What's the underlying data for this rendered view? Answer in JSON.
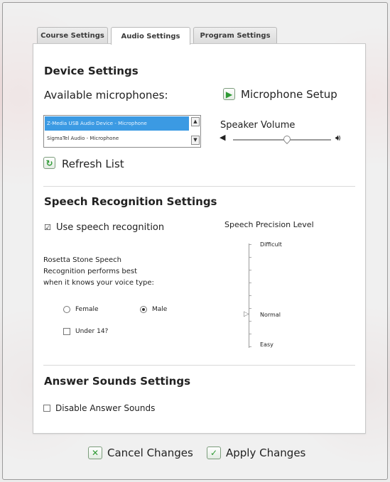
{
  "tabs": [
    {
      "label": "Course Settings"
    },
    {
      "label": "Audio Settings"
    },
    {
      "label": "Program Settings"
    }
  ],
  "device": {
    "title": "Device Settings",
    "available_label": "Available microphones:",
    "microphones": [
      "Z-Media USB Audio Device - Microphone",
      "SigmaTel Audio - Microphone"
    ],
    "mic_setup_label": "Microphone Setup",
    "speaker_volume_label": "Speaker Volume",
    "speaker_volume_level": 0.55,
    "refresh_label": "Refresh List"
  },
  "speech": {
    "title": "Speech Recognition Settings",
    "use_label": "Use speech recognition",
    "use_checked": true,
    "info_text_lines": [
      "Rosetta Stone Speech",
      "Recognition performs best",
      "when it knows your voice type:"
    ],
    "female_label": "Female",
    "male_label": "Male",
    "selected_voice": "Male",
    "under14_label": "Under 14?",
    "precision_title": "Speech Precision Level",
    "precision_levels": [
      "Difficult",
      "Normal",
      "Easy"
    ],
    "precision_selected": "Normal"
  },
  "answer": {
    "title": "Answer Sounds Settings",
    "disable_label": "Disable Answer Sounds",
    "disable_checked": false
  },
  "footer": {
    "cancel_label": "Cancel Changes",
    "apply_label": "Apply Changes"
  },
  "colors": {
    "accent_green": "#2e9a34",
    "selection_blue": "#3b9ae3"
  }
}
